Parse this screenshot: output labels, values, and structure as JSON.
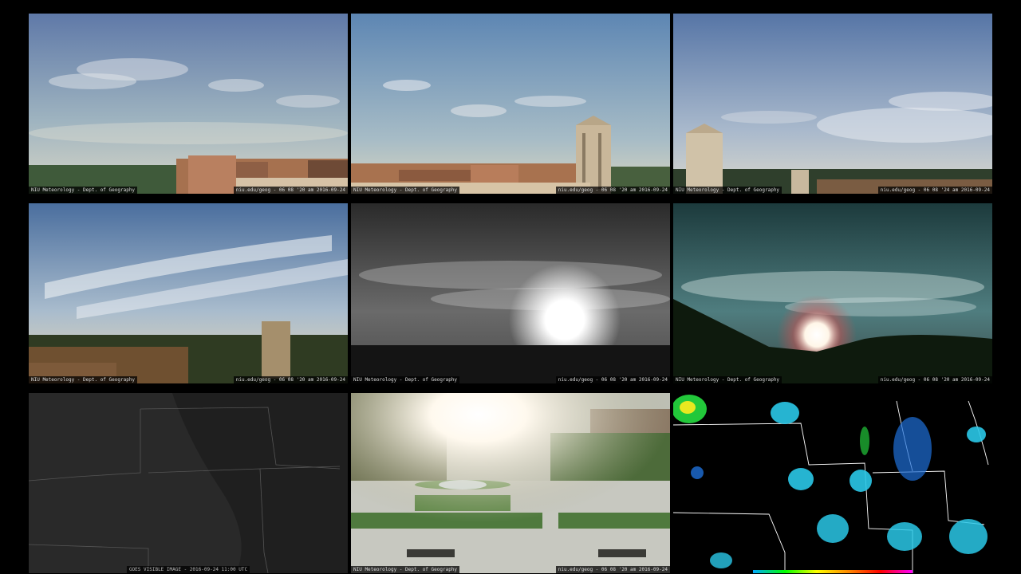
{
  "tiles": [
    {
      "name": "cam-west",
      "cap_left": "NIU Meteorology - Dept. of Geography",
      "cap_right": "niu.edu/geog - 06 08 '20 am 2016-09-24"
    },
    {
      "name": "cam-north",
      "cap_left": "NIU Meteorology - Dept. of Geography",
      "cap_right": "niu.edu/geog - 06 08 '20 am 2016-09-24"
    },
    {
      "name": "cam-northeast",
      "cap_left": "NIU Meteorology - Dept. of Geography",
      "cap_right": "niu.edu/geog - 06 08 '24 am 2016-09-24"
    },
    {
      "name": "cam-south",
      "cap_left": "NIU Meteorology - Dept. of Geography",
      "cap_right": "niu.edu/geog - 06 08 '20 am 2016-09-24"
    },
    {
      "name": "cam-east-bw",
      "cap_left": "NIU Meteorology - Dept. of Geography",
      "cap_right": "niu.edu/geog - 06 08 '20 am 2016-09-24"
    },
    {
      "name": "cam-east-color",
      "cap_left": "NIU Meteorology - Dept. of Geography",
      "cap_right": "niu.edu/geog - 06 08 '20 am 2016-09-24"
    },
    {
      "name": "satellite",
      "cap_center": "GOES VISIBLE IMAGE - 2016-09-24 11:00 UTC"
    },
    {
      "name": "cam-plaza",
      "cap_left": "NIU Meteorology - Dept. of Geography",
      "cap_right": "niu.edu/geog - 06 08 '20 am 2016-09-24"
    },
    {
      "name": "radar"
    }
  ],
  "colors": {
    "sky_top": "#5b7fae",
    "sky_bottom": "#c9d6d8",
    "brick": "#a6714f",
    "radar_light": "#2ac8e8",
    "radar_mid": "#1e6fd8",
    "radar_green": "#22c83a"
  }
}
